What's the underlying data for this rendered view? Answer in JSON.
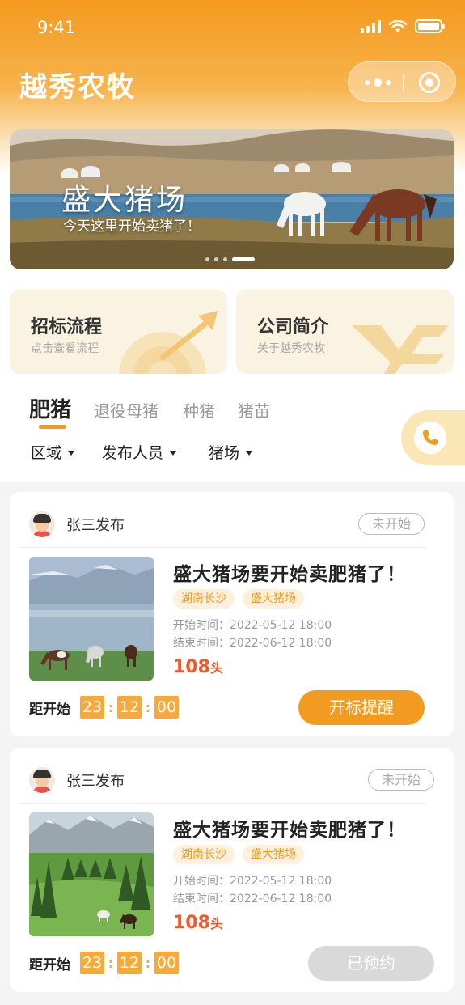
{
  "status_bar": {
    "time": "9:41"
  },
  "app": {
    "title": "越秀农牧"
  },
  "banner": {
    "title": "盛大猪场",
    "subtitle": "今天这里开始卖猪了！"
  },
  "entries": [
    {
      "title": "招标流程",
      "subtitle": "点击查看流程"
    },
    {
      "title": "公司简介",
      "subtitle": "关于越秀农牧"
    }
  ],
  "tabs": [
    {
      "label": "肥猪",
      "active": true
    },
    {
      "label": "退役母猪",
      "active": false
    },
    {
      "label": "种猪",
      "active": false
    },
    {
      "label": "猪苗",
      "active": false
    }
  ],
  "filters": [
    {
      "label": "区域"
    },
    {
      "label": "发布人员"
    },
    {
      "label": "猪场"
    }
  ],
  "listings": [
    {
      "publisher": "张三发布",
      "status": "未开始",
      "title": "盛大猪场要开始卖肥猪了！",
      "tags": [
        "湖南长沙",
        "盛大猪场"
      ],
      "start_time": "开始时间：2022-05-12   18:00",
      "end_time": "结束时间：2022-06-12   18:00",
      "count": "108",
      "count_unit": "头",
      "countdown_label": "距开始",
      "countdown": [
        "23",
        "12",
        "00"
      ],
      "action": "开标提醒"
    },
    {
      "publisher": "张三发布",
      "status": "未开始",
      "title": "盛大猪场要开始卖肥猪了！",
      "tags": [
        "湖南长沙",
        "盛大猪场"
      ],
      "start_time": "开始时间：2022-05-12   18:00",
      "end_time": "结束时间：2022-06-12   18:00",
      "count": "108",
      "count_unit": "头",
      "countdown_label": "距开始",
      "countdown": [
        "23",
        "12",
        "00"
      ],
      "action": "已预约"
    }
  ],
  "colors": {
    "accent": "#f39a20",
    "price": "#f25a2c",
    "tag_bg": "#fdf0dc"
  }
}
